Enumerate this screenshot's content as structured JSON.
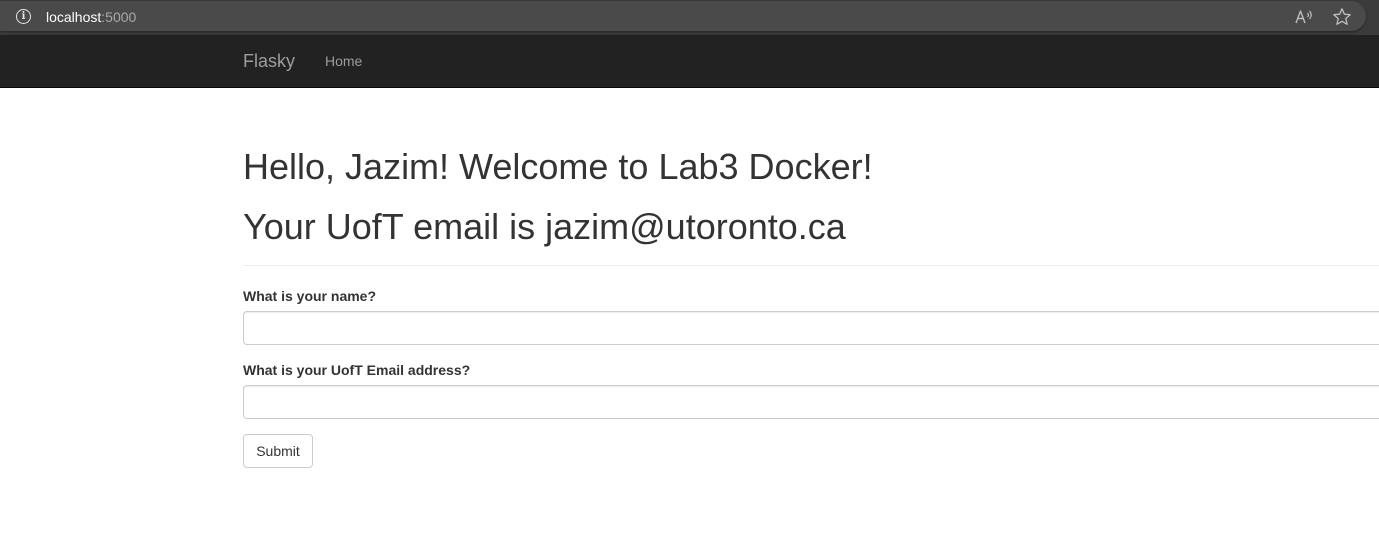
{
  "browser": {
    "url_host": "localhost",
    "url_port": ":5000",
    "info_icon": "info-icon",
    "read_aloud_icon": "read-aloud-icon",
    "favorite_icon": "star-icon"
  },
  "navbar": {
    "brand": "Flasky",
    "links": [
      {
        "label": "Home"
      }
    ],
    "background_color": "#222222",
    "link_color": "#9d9d9d"
  },
  "main": {
    "greeting": "Hello, Jazim! Welcome to Lab3 Docker!",
    "email_line": "Your UofT email is jazim@utoronto.ca"
  },
  "form": {
    "name_label": "What is your name?",
    "name_value": "",
    "email_label": "What is your UofT Email address?",
    "email_value": "",
    "submit_label": "Submit"
  }
}
